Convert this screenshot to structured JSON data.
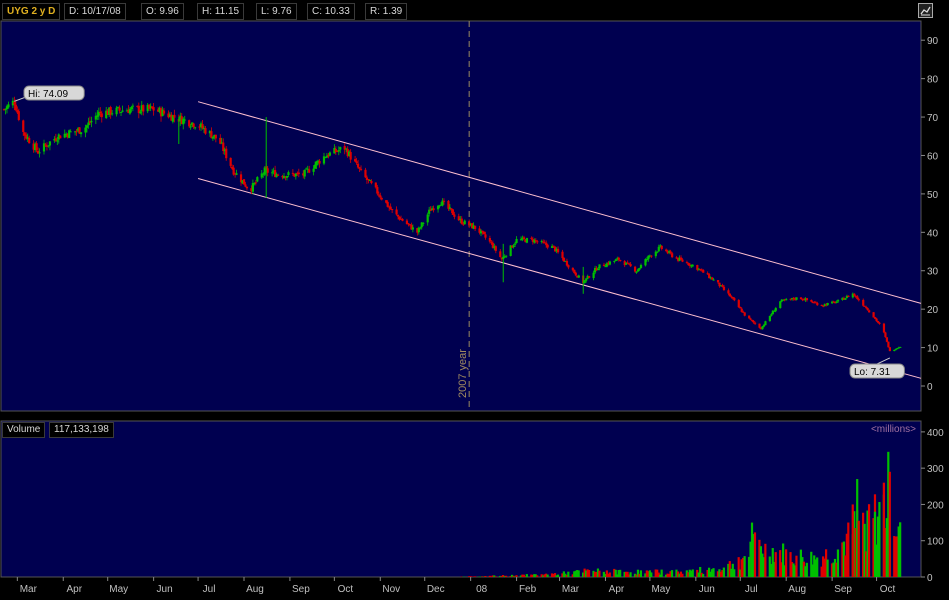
{
  "header": {
    "symbol": "UYG 2 y D",
    "date": "D: 10/17/08",
    "open": "O: 9.96",
    "high": "H: 11.15",
    "low": "L: 9.76",
    "close": "C: 10.33",
    "range": "R: 1.39"
  },
  "volume_panel": {
    "label": "Volume",
    "value": "117,133,198",
    "units": "<millions>"
  },
  "colors": {
    "panel_bg": "#000050",
    "up": "#00c000",
    "down": "#e00000",
    "channel": "#ffc0d0",
    "grid": "#4a4a4a"
  },
  "icons": {
    "settings": "chart-settings-icon"
  },
  "chart_data": [
    {
      "type": "candlestick",
      "ylim": [
        0,
        95
      ],
      "yticks": [
        0,
        10,
        20,
        30,
        40,
        50,
        60,
        70,
        80,
        90
      ],
      "x_labels": [
        "Mar",
        "Apr",
        "May",
        "Jun",
        "Jul",
        "Aug",
        "Sep",
        "Oct",
        "Nov",
        "Dec",
        "08",
        "Feb",
        "Mar",
        "Apr",
        "May",
        "Jun",
        "Jul",
        "Aug",
        "Sep",
        "Oct"
      ],
      "annotations": {
        "high": "Hi: 74.09",
        "low": "Lo: 7.31",
        "separator": "2007 year"
      },
      "path_points": [
        [
          "2007-02-20",
          72
        ],
        [
          "2007-02-27",
          74.09
        ],
        [
          "2007-03-05",
          66
        ],
        [
          "2007-03-15",
          61
        ],
        [
          "2007-03-28",
          65
        ],
        [
          "2007-04-15",
          67
        ],
        [
          "2007-04-25",
          71
        ],
        [
          "2007-05-15",
          72
        ],
        [
          "2007-06-01",
          72
        ],
        [
          "2007-06-15",
          70
        ],
        [
          "2007-07-01",
          68
        ],
        [
          "2007-07-15",
          64
        ],
        [
          "2007-07-25",
          56
        ],
        [
          "2007-08-05",
          51
        ],
        [
          "2007-08-15",
          56
        ],
        [
          "2007-08-25",
          55
        ],
        [
          "2007-09-10",
          55
        ],
        [
          "2007-09-25",
          60
        ],
        [
          "2007-10-08",
          62
        ],
        [
          "2007-10-20",
          55
        ],
        [
          "2007-10-31",
          50
        ],
        [
          "2007-11-10",
          45
        ],
        [
          "2007-11-26",
          40
        ],
        [
          "2007-12-05",
          46
        ],
        [
          "2007-12-12",
          48
        ],
        [
          "2007-12-25",
          43
        ],
        [
          "2008-01-05",
          41
        ],
        [
          "2008-01-15",
          37
        ],
        [
          "2008-01-22",
          33
        ],
        [
          "2008-02-01",
          38
        ],
        [
          "2008-02-12",
          38
        ],
        [
          "2008-02-26",
          36
        ],
        [
          "2008-03-10",
          30
        ],
        [
          "2008-03-17",
          27
        ],
        [
          "2008-03-27",
          31
        ],
        [
          "2008-04-10",
          33
        ],
        [
          "2008-04-22",
          30
        ],
        [
          "2008-05-01",
          34
        ],
        [
          "2008-05-08",
          36
        ],
        [
          "2008-05-20",
          33
        ],
        [
          "2008-06-01",
          31
        ],
        [
          "2008-06-15",
          27
        ],
        [
          "2008-06-25",
          23
        ],
        [
          "2008-07-05",
          18
        ],
        [
          "2008-07-15",
          15
        ],
        [
          "2008-07-28",
          22
        ],
        [
          "2008-08-10",
          23
        ],
        [
          "2008-08-25",
          21
        ],
        [
          "2008-09-05",
          22
        ],
        [
          "2008-09-15",
          24
        ],
        [
          "2008-09-25",
          20
        ],
        [
          "2008-10-05",
          15
        ],
        [
          "2008-10-10",
          9
        ],
        [
          "2008-10-17",
          10.33
        ]
      ],
      "channel": {
        "upper": [
          [
            "2007-07-01",
            74
          ],
          [
            "2008-10-31",
            21.5
          ]
        ],
        "lower": [
          [
            "2007-07-01",
            54
          ],
          [
            "2008-10-31",
            2
          ]
        ]
      }
    },
    {
      "type": "bar",
      "ylabel": "<millions>",
      "ylim": [
        0,
        430
      ],
      "yticks": [
        0,
        100,
        200,
        300,
        400
      ],
      "path_points": [
        [
          "2007-12-26",
          1
        ],
        [
          "2008-01-15",
          3
        ],
        [
          "2008-02-10",
          6
        ],
        [
          "2008-03-01",
          10
        ],
        [
          "2008-03-20",
          18
        ],
        [
          "2008-04-10",
          16
        ],
        [
          "2008-05-01",
          15
        ],
        [
          "2008-05-20",
          16
        ],
        [
          "2008-06-05",
          20
        ],
        [
          "2008-06-20",
          28
        ],
        [
          "2008-07-01",
          50
        ],
        [
          "2008-07-10",
          90
        ],
        [
          "2008-07-18",
          80
        ],
        [
          "2008-07-25",
          75
        ],
        [
          "2008-08-05",
          60
        ],
        [
          "2008-08-20",
          55
        ],
        [
          "2008-09-01",
          70
        ],
        [
          "2008-09-12",
          110
        ],
        [
          "2008-09-20",
          160
        ],
        [
          "2008-09-30",
          170
        ],
        [
          "2008-10-10",
          220
        ],
        [
          "2008-10-17",
          117
        ]
      ],
      "spikes": [
        [
          "2008-07-09",
          150
        ],
        [
          "2008-09-15",
          200
        ],
        [
          "2008-09-18",
          270
        ],
        [
          "2008-09-19",
          155
        ],
        [
          "2008-09-30",
          180
        ],
        [
          "2008-10-06",
          260
        ],
        [
          "2008-10-09",
          345
        ],
        [
          "2008-10-10",
          290
        ]
      ]
    }
  ]
}
